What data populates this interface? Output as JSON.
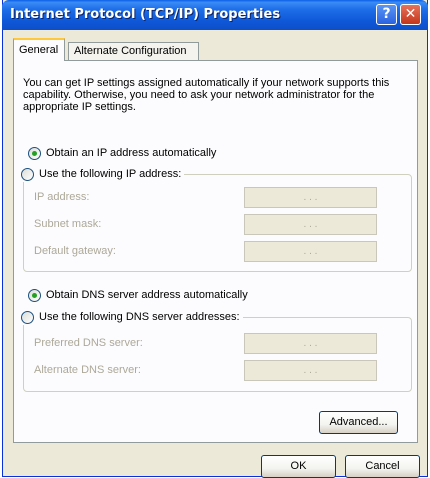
{
  "window": {
    "title": "Internet Protocol (TCP/IP) Properties",
    "help_glyph": "?",
    "close_glyph": "✕"
  },
  "tabs": [
    {
      "label": "General",
      "active": true
    },
    {
      "label": "Alternate Configuration",
      "active": false
    }
  ],
  "intro_text": "You can get IP settings assigned automatically if your network supports this capability. Otherwise, you need to ask your network administrator for the appropriate IP settings.",
  "ip_section": {
    "auto_label": "Obtain an IP address automatically",
    "auto_selected": true,
    "manual_label": "Use the following IP address:",
    "fields": [
      {
        "label": "IP address:",
        "value": ". . ."
      },
      {
        "label": "Subnet mask:",
        "value": ". . ."
      },
      {
        "label": "Default gateway:",
        "value": ". . ."
      }
    ]
  },
  "dns_section": {
    "auto_label": "Obtain DNS server address automatically",
    "auto_selected": true,
    "manual_label": "Use the following DNS server addresses:",
    "fields": [
      {
        "label": "Preferred DNS server:",
        "value": ". . ."
      },
      {
        "label": "Alternate DNS server:",
        "value": ". . ."
      }
    ]
  },
  "buttons": {
    "advanced": "Advanced...",
    "ok": "OK",
    "cancel": "Cancel"
  },
  "colors": {
    "titlebar": "#0d58d8",
    "dialog_bg": "#ece9d8",
    "panel_bg": "#fcfcfe",
    "disabled_text": "#aca899",
    "radio_dot": "#21a121",
    "tab_highlight": "#ffc83c"
  }
}
